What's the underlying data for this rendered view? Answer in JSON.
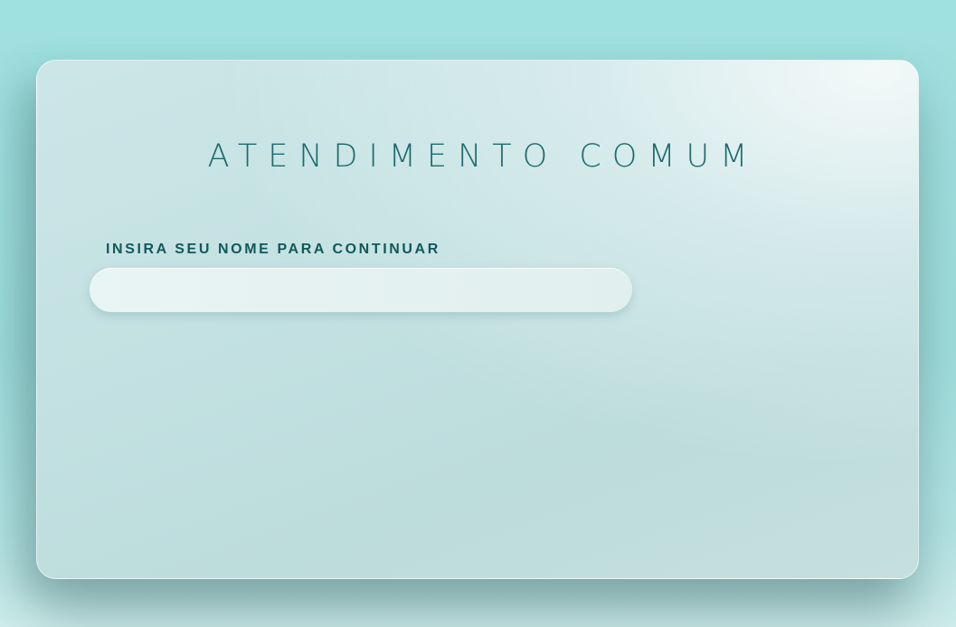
{
  "form": {
    "title": "ATENDIMENTO COMUM",
    "name_label": "INSIRA SEU NOME PARA CONTINUAR",
    "name_value": "",
    "name_placeholder": ""
  },
  "colors": {
    "background": "#9fe1e0",
    "card": "#c3e1e2",
    "title_text": "#1d6b6c",
    "label_text": "#12585a",
    "input_background": "#e6f2f2"
  }
}
